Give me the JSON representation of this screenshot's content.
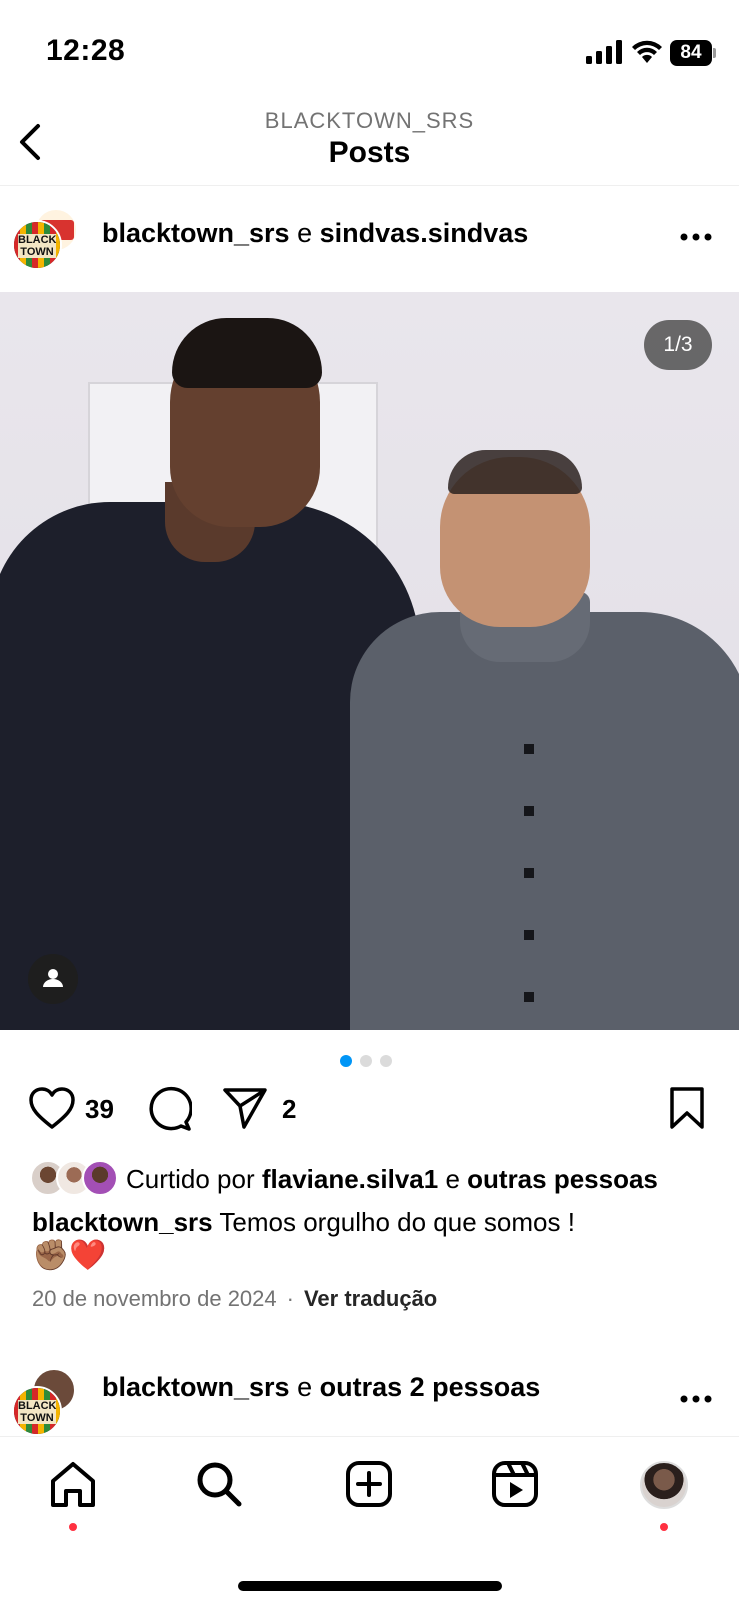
{
  "status": {
    "time": "12:28",
    "battery": "84"
  },
  "header": {
    "account": "BLACKTOWN_SRS",
    "title": "Posts"
  },
  "post": {
    "user1": "blacktown_srs",
    "connector": "e",
    "user2": "sindvas.sindvas",
    "avatar_logo_text": "BLACK TOWN",
    "photo_counter": "1/3",
    "pager": {
      "count": 3,
      "active": 1
    },
    "likes_count": "39",
    "shares_count": "2",
    "liked_by_prefix": "Curtido por",
    "liked_by_user": "flaviane.silva1",
    "liked_by_connector": "e",
    "liked_by_others": "outras pessoas",
    "caption_user": "blacktown_srs",
    "caption_text": "Temos orgulho do que somos !",
    "caption_emoji": "✊🏽❤️",
    "date": "20 de novembro de 2024",
    "meta_separator": "·",
    "translate_label": "Ver tradução"
  },
  "post2": {
    "user1": "blacktown_srs",
    "connector": "e",
    "others": "outras 2 pessoas"
  },
  "icons": {
    "back": "chevron-left-icon",
    "more": "ellipsis-icon",
    "like": "heart-icon",
    "comment": "comment-icon",
    "share": "send-icon",
    "save": "bookmark-icon",
    "tag": "person-icon",
    "home": "home-icon",
    "search": "search-icon",
    "create": "plus-square-icon",
    "reels": "reels-icon"
  },
  "colors": {
    "notification_dot": "#ff3040",
    "pager_active": "#0095f6",
    "pager_inactive": "#dbdbdb"
  }
}
